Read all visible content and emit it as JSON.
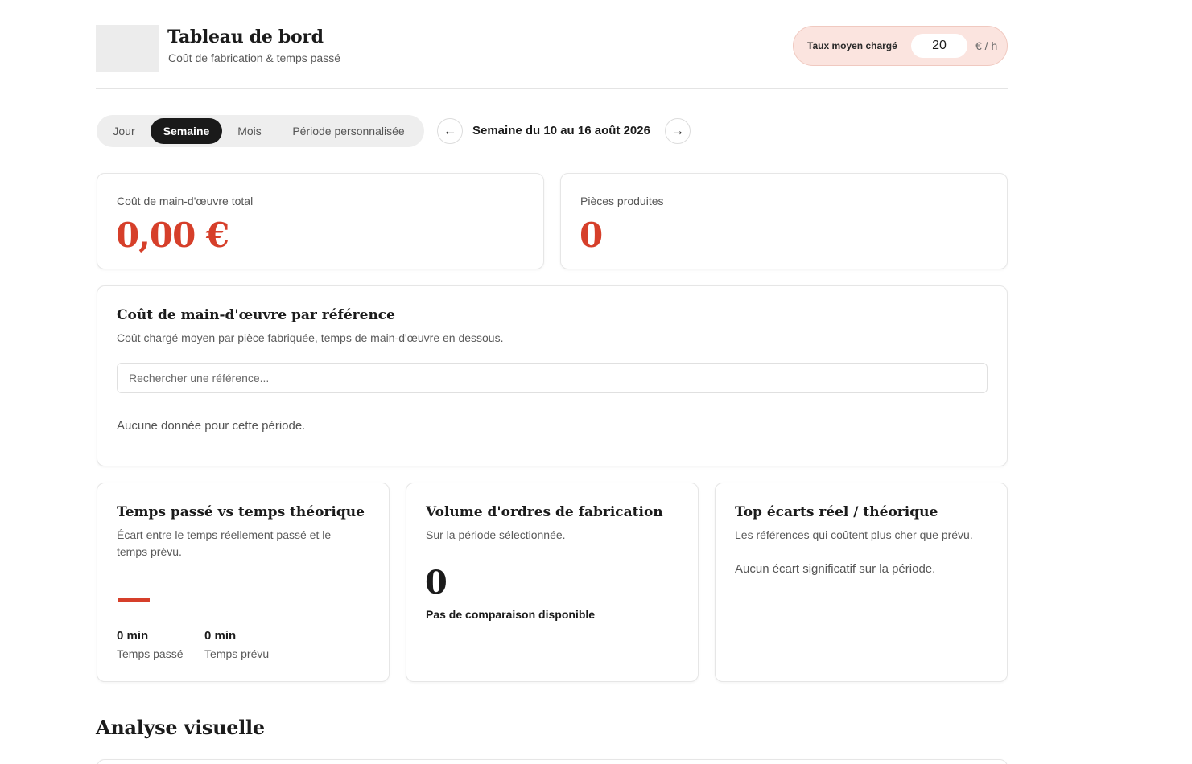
{
  "header": {
    "title": "Tableau de bord",
    "subtitle": "Coût de fabrication & temps passé",
    "rate": {
      "label": "Taux moyen chargé",
      "value": "20",
      "unit": "€ / h"
    }
  },
  "period": {
    "tabs": [
      {
        "label": "Jour",
        "active": false
      },
      {
        "label": "Semaine",
        "active": true
      },
      {
        "label": "Mois",
        "active": false
      },
      {
        "label": "Période personnalisée",
        "active": false
      }
    ],
    "prev_icon": "←",
    "next_icon": "→",
    "label": "Semaine du 10 au 16 août 2026"
  },
  "kpis": {
    "labor_cost": {
      "label": "Coût de main-d'œuvre total",
      "value": "0,00 €"
    },
    "pieces": {
      "label": "Pièces produites",
      "value": "0"
    }
  },
  "by_reference": {
    "title": "Coût de main-d'œuvre par référence",
    "subtitle": "Coût chargé moyen par pièce fabriquée, temps de main-d'œuvre en dessous.",
    "search_placeholder": "Rechercher une référence...",
    "empty": "Aucune donnée pour cette période."
  },
  "time_card": {
    "title": "Temps passé vs temps théorique",
    "subtitle_line1": "Écart entre le temps réellement passé et le",
    "subtitle_line2": "temps prévu.",
    "spent_value": "0 min",
    "spent_label": "Temps passé",
    "planned_value": "0 min",
    "planned_label": "Temps prévu"
  },
  "orders_card": {
    "title": "Volume d'ordres de fabrication",
    "subtitle": "Sur la période sélectionnée.",
    "value": "0",
    "note": "Pas de comparaison disponible"
  },
  "gaps_card": {
    "title": "Top écarts réel / théorique",
    "subtitle": "Les références qui coûtent plus cher que prévu.",
    "empty": "Aucun écart significatif sur la période."
  },
  "analysis": {
    "title": "Analyse visuelle"
  },
  "colors": {
    "accent": "#d63f2a",
    "rate_bg": "#fbe4df",
    "active_tab": "#1a1a1a"
  }
}
